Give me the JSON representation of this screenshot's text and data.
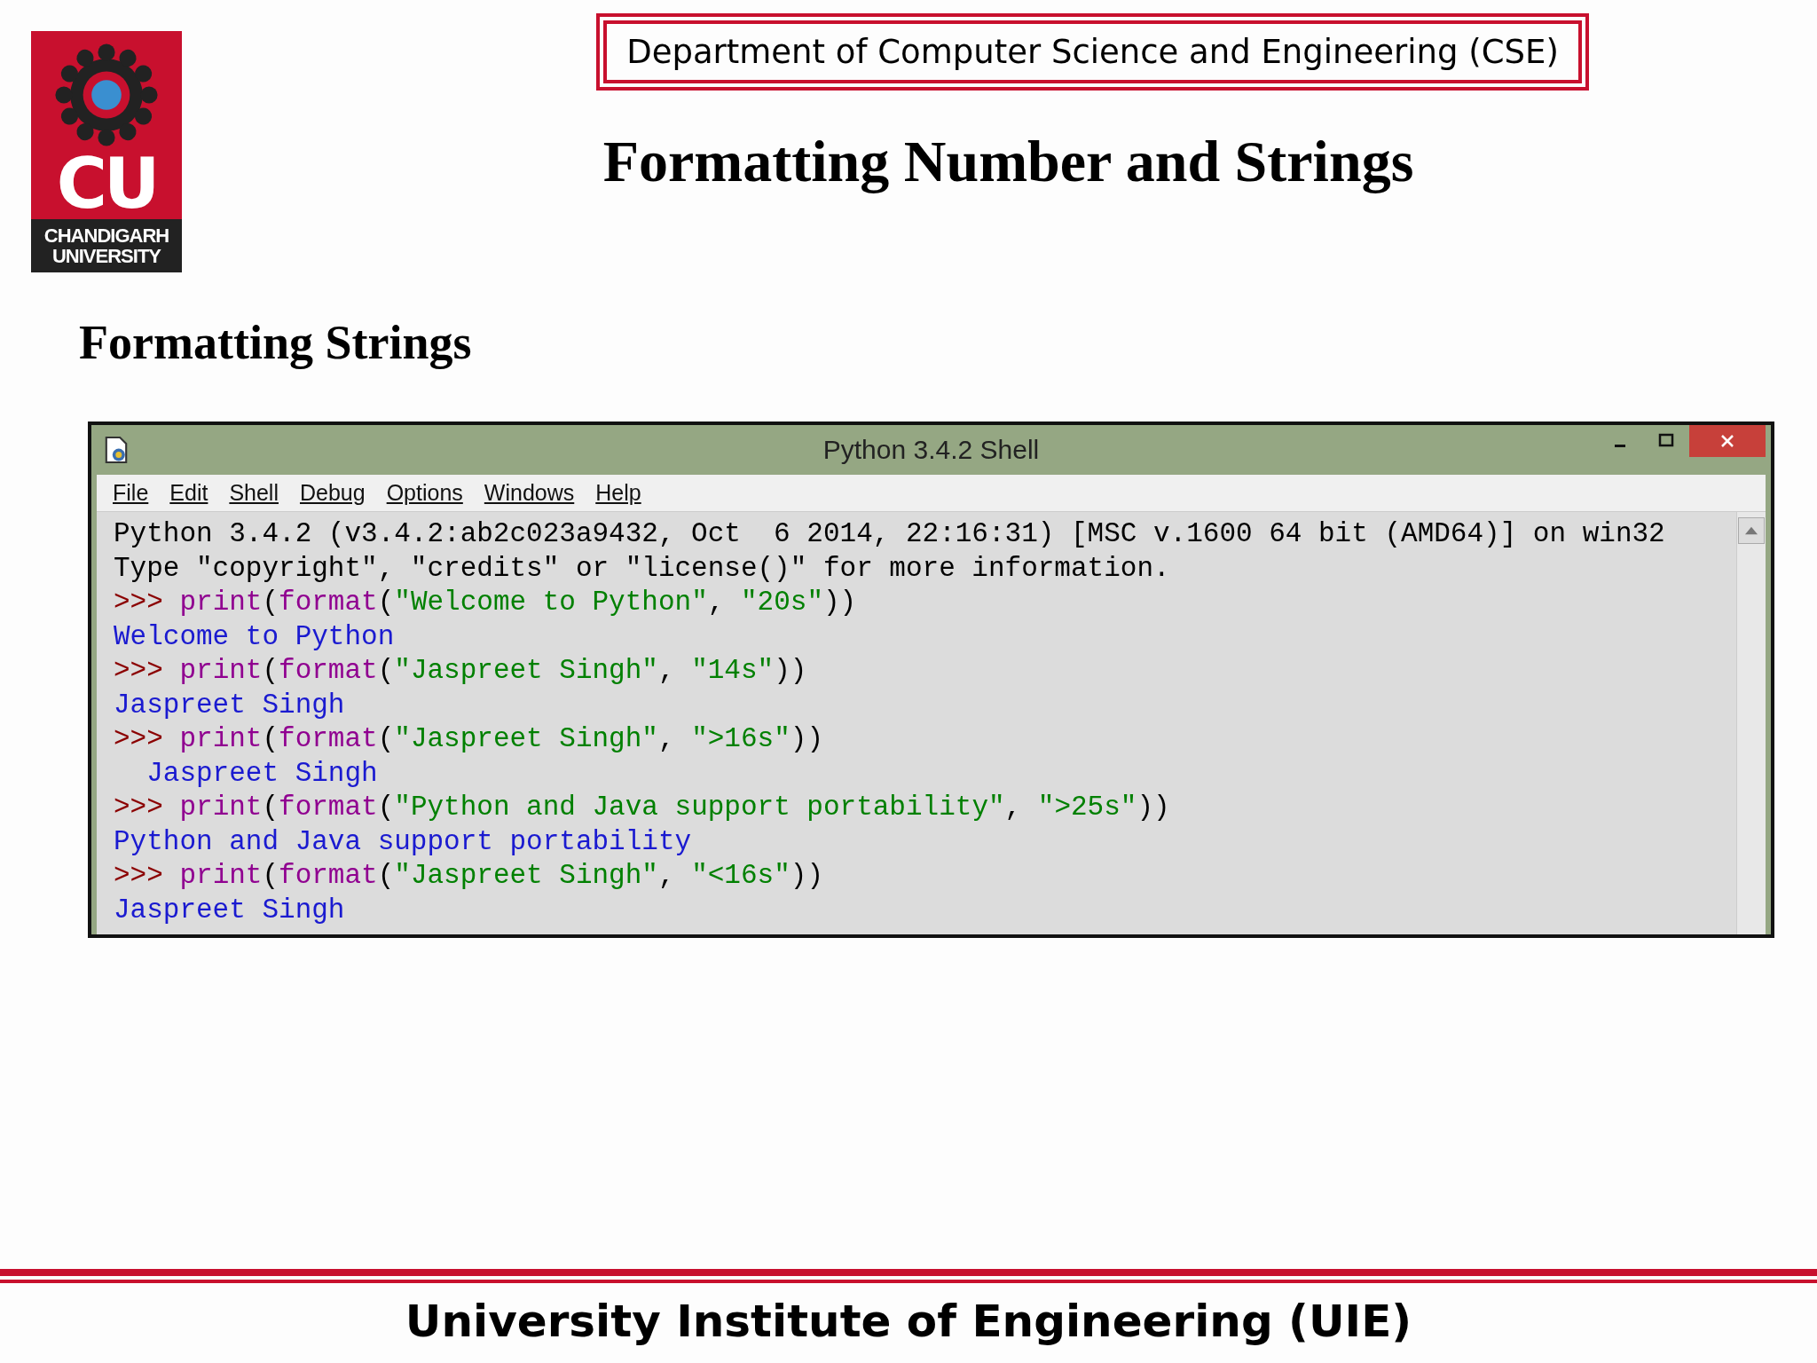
{
  "logo": {
    "letters": "CU",
    "name_lines": [
      "CHANDIGARH",
      "UNIVERSITY"
    ]
  },
  "department": "Department of Computer Science and Engineering (CSE)",
  "title": "Formatting Number and Strings",
  "section_heading": "Formatting Strings",
  "shell": {
    "title": "Python 3.4.2 Shell",
    "menu": [
      "File",
      "Edit",
      "Shell",
      "Debug",
      "Options",
      "Windows",
      "Help"
    ],
    "lines": [
      [
        {
          "kind": "plain",
          "text": "Python 3.4.2 (v3.4.2:ab2c023a9432, Oct  6 2014, 22:16:31) [MSC v.1600 64 bit (AMD64)] on win32"
        }
      ],
      [
        {
          "kind": "plain",
          "text": "Type \"copyright\", \"credits\" or \"license()\" for more information."
        }
      ],
      [
        {
          "kind": "prompt",
          "text": ">>> "
        },
        {
          "kind": "builtin",
          "text": "print"
        },
        {
          "kind": "plain",
          "text": "("
        },
        {
          "kind": "builtin",
          "text": "format"
        },
        {
          "kind": "plain",
          "text": "("
        },
        {
          "kind": "string",
          "text": "\"Welcome to Python\""
        },
        {
          "kind": "plain",
          "text": ", "
        },
        {
          "kind": "string",
          "text": "\"20s\""
        },
        {
          "kind": "plain",
          "text": "))"
        }
      ],
      [
        {
          "kind": "output",
          "text": "Welcome to Python"
        }
      ],
      [
        {
          "kind": "prompt",
          "text": ">>> "
        },
        {
          "kind": "builtin",
          "text": "print"
        },
        {
          "kind": "plain",
          "text": "("
        },
        {
          "kind": "builtin",
          "text": "format"
        },
        {
          "kind": "plain",
          "text": "("
        },
        {
          "kind": "string",
          "text": "\"Jaspreet Singh\""
        },
        {
          "kind": "plain",
          "text": ", "
        },
        {
          "kind": "string",
          "text": "\"14s\""
        },
        {
          "kind": "plain",
          "text": "))"
        }
      ],
      [
        {
          "kind": "output",
          "text": "Jaspreet Singh"
        }
      ],
      [
        {
          "kind": "prompt",
          "text": ">>> "
        },
        {
          "kind": "builtin",
          "text": "print"
        },
        {
          "kind": "plain",
          "text": "("
        },
        {
          "kind": "builtin",
          "text": "format"
        },
        {
          "kind": "plain",
          "text": "("
        },
        {
          "kind": "string",
          "text": "\"Jaspreet Singh\""
        },
        {
          "kind": "plain",
          "text": ", "
        },
        {
          "kind": "string",
          "text": "\">16s\""
        },
        {
          "kind": "plain",
          "text": "))"
        }
      ],
      [
        {
          "kind": "output",
          "text": "  Jaspreet Singh"
        }
      ],
      [
        {
          "kind": "prompt",
          "text": ">>> "
        },
        {
          "kind": "builtin",
          "text": "print"
        },
        {
          "kind": "plain",
          "text": "("
        },
        {
          "kind": "builtin",
          "text": "format"
        },
        {
          "kind": "plain",
          "text": "("
        },
        {
          "kind": "string",
          "text": "\"Python and Java support portability\""
        },
        {
          "kind": "plain",
          "text": ", "
        },
        {
          "kind": "string",
          "text": "\">25s\""
        },
        {
          "kind": "plain",
          "text": "))"
        }
      ],
      [
        {
          "kind": "output",
          "text": "Python and Java support portability"
        }
      ],
      [
        {
          "kind": "prompt",
          "text": ">>> "
        },
        {
          "kind": "builtin",
          "text": "print"
        },
        {
          "kind": "plain",
          "text": "("
        },
        {
          "kind": "builtin",
          "text": "format"
        },
        {
          "kind": "plain",
          "text": "("
        },
        {
          "kind": "string",
          "text": "\"Jaspreet Singh\""
        },
        {
          "kind": "plain",
          "text": ", "
        },
        {
          "kind": "string",
          "text": "\"<16s\""
        },
        {
          "kind": "plain",
          "text": "))"
        }
      ],
      [
        {
          "kind": "output",
          "text": "Jaspreet Singh"
        }
      ]
    ]
  },
  "footer": "University Institute of Engineering (UIE)"
}
